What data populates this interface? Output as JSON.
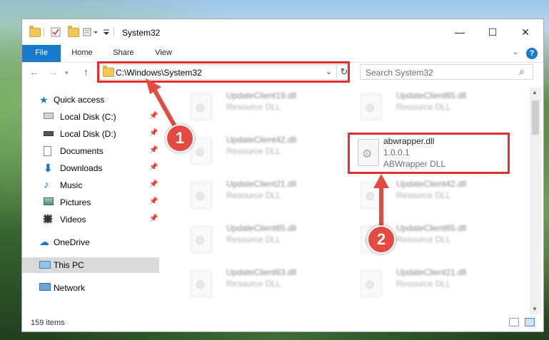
{
  "window": {
    "title": "System32"
  },
  "ribbon": {
    "tabs": [
      "File",
      "Home",
      "Share",
      "View"
    ],
    "help": "?"
  },
  "nav": {
    "address": "C:\\Windows\\System32",
    "search_placeholder": "Search System32"
  },
  "sidebar": {
    "quick_access": "Quick access",
    "items": [
      "Local Disk (C:)",
      "Local Disk (D:)",
      "Documents",
      "Downloads",
      "Music",
      "Pictures",
      "Videos"
    ],
    "onedrive": "OneDrive",
    "this_pc": "This PC",
    "network": "Network"
  },
  "files": [
    {
      "name": "UpdateClient19.dll",
      "type": "Resource DLL"
    },
    {
      "name": "UpdateClient65.dll",
      "type": "Resource DLL"
    },
    {
      "name": "UpdateClient42.dll",
      "type": "Resource DLL"
    },
    {
      "name": "abwrapper.dll",
      "version": "1.0.0.1",
      "type": "ABWrapper DLL"
    },
    {
      "name": "UpdateClient21.dll",
      "type": "Resource DLL"
    },
    {
      "name": "UpdateClient42.dll",
      "type": "Resource DLL"
    },
    {
      "name": "UpdateClient65.dll",
      "type": "Resource DLL"
    },
    {
      "name": "UpdateClient65.dll",
      "type": "Resource DLL"
    },
    {
      "name": "UpdateClient63.dll",
      "type": "Resource DLL"
    },
    {
      "name": "UpdateClient21.dll",
      "type": "Resource DLL"
    }
  ],
  "status": {
    "count": "159 items"
  },
  "annotations": {
    "step1": "1",
    "step2": "2"
  },
  "colors": {
    "accent": "#1979ca",
    "highlight": "#e03030"
  }
}
